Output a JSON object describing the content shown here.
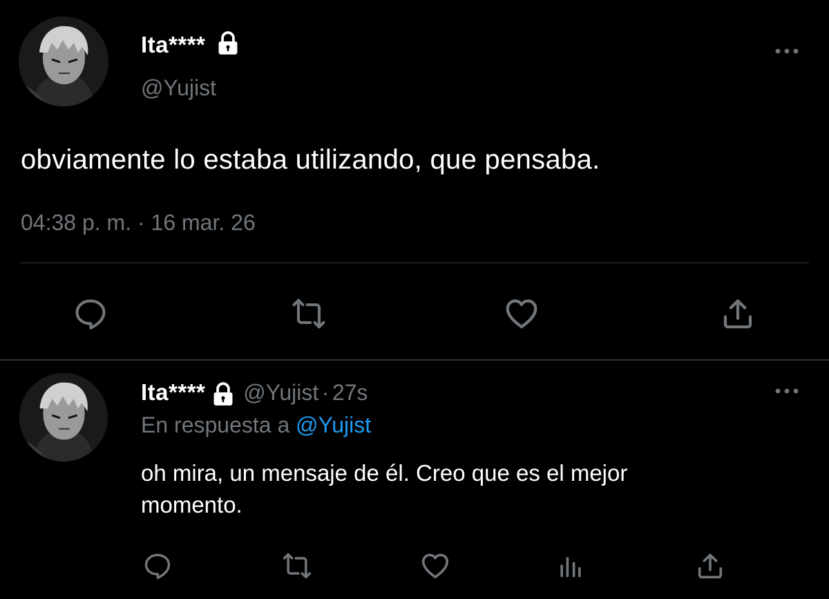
{
  "main_tweet": {
    "display_name": "Ita****",
    "handle": "@Yujist",
    "text": "obviamente lo estaba utilizando, que pensaba.",
    "timestamp": "04:38 p. m. · 16 mar. 26",
    "avatar_icon": "avatar-anime-character",
    "lock_icon": "lock-icon",
    "more_icon": "more-horizontal-icon",
    "actions": [
      "reply-icon",
      "retweet-icon",
      "like-icon",
      "share-icon"
    ]
  },
  "reply_tweet": {
    "display_name": "Ita****",
    "handle": "@Yujist",
    "separator": "·",
    "time_ago": "27s",
    "reply_prefix": "En respuesta a",
    "reply_to": "@Yujist",
    "text_line1": "oh mira, un mensaje de él. Creo que es el mejor",
    "text_line2": "momento.",
    "actions": [
      "reply-icon",
      "retweet-icon",
      "like-icon",
      "analytics-icon",
      "share-icon"
    ]
  },
  "colors": {
    "background": "#000000",
    "text_primary": "#ffffff",
    "text_secondary": "#71767b",
    "link": "#1d9bf0",
    "divider": "#2f3336"
  }
}
